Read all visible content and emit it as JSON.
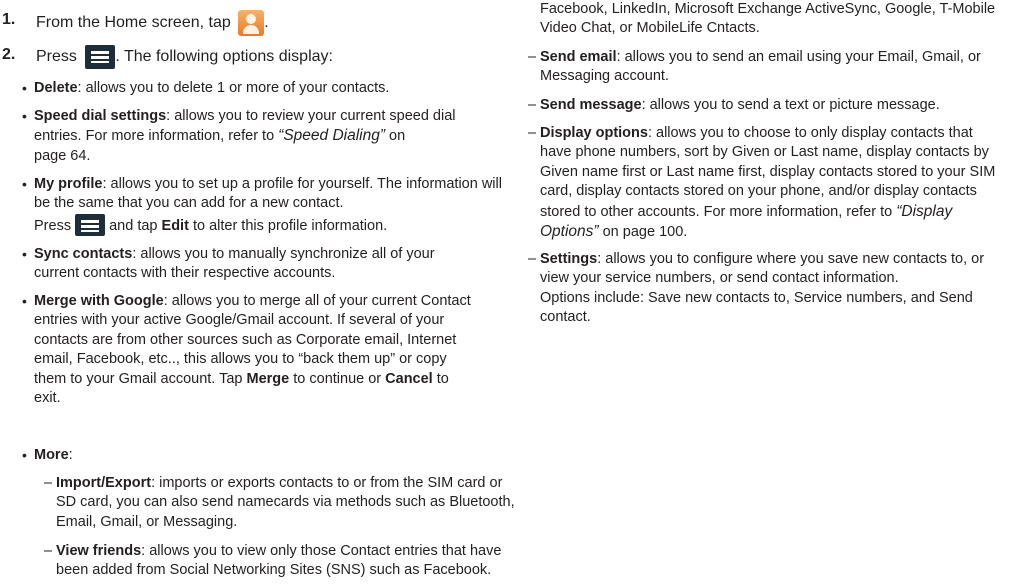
{
  "step1": {
    "num": "1.",
    "text_a": "From the Home screen, tap",
    "text_b": "."
  },
  "step2": {
    "num": "2.",
    "text_a": "Press",
    "text_b": ". The following options display:"
  },
  "left_items": {
    "delete": {
      "label": "Delete",
      "text": ": allows you to delete 1 or more of your contacts."
    },
    "speed": {
      "label": "Speed dial settings",
      "l1": ": allows you to review your current speed dial",
      "l2a": "entries. For more information, refer to ",
      "ref": "“Speed Dialing”",
      "l2b": "  on",
      "l3": "page 64."
    },
    "profile": {
      "label": "My profile",
      "l1": ": allows you to set up a profile for yourself. The information will",
      "l2": "be the same that you can add for a new contact.",
      "l3a": "Press ",
      "l3b": " and tap ",
      "edit": "Edit",
      "l3c": " to alter this profile information."
    },
    "sync": {
      "label": "Sync contacts",
      "l1": ": allows you to manually synchronize all of your",
      "l2": "current contacts with their respective accounts."
    },
    "merge": {
      "label": "Merge with Google",
      "l1": ": allows you to merge all of your current Contact",
      "l2": "entries with your active Google/Gmail account. If several of your",
      "l3": "contacts are from other sources such as Corporate email, Internet",
      "l4": "email, Facebook, etc.., this allows you to “back them up” or copy",
      "l5a": "them to your Gmail account. Tap ",
      "merge_btn": "Merge",
      "l5b": " to continue or ",
      "cancel_btn": "Cancel",
      "l5c": " to",
      "l6": "exit."
    },
    "more": {
      "label": "More",
      "text": ":"
    },
    "import": {
      "label": "Import/Export",
      "l1": ": imports or exports contacts to or from the SIM card or",
      "l2": "SD card, you can also send namecards via methods such as Bluetooth,",
      "l3": "Email, Gmail, or Messaging."
    },
    "friends": {
      "label": "View friends",
      "l1": ": allows you to view only those Contact entries that have",
      "l2": "been added from Social Networking Sites (SNS) such as Facebook."
    }
  },
  "right_items": {
    "cont": {
      "l1": "Facebook, LinkedIn, Microsoft Exchange ActiveSync, Google, T-Mobile",
      "l2": "Video Chat, or MobileLife Cntacts."
    },
    "email": {
      "label": "Send email",
      "l1": ": allows you to send an email using your Email, Gmail, or",
      "l2": "Messaging account."
    },
    "message": {
      "label": "Send message",
      "text": ": allows you to send a text or picture message."
    },
    "display": {
      "label": "Display options",
      "l1": ": allows you to choose to only display contacts that",
      "l2": "have phone numbers, sort by Given or Last name, display contacts by",
      "l3": "Given name first or Last name first, display contacts stored to your SIM",
      "l4": "card, display contacts stored on your phone, and/or display contacts",
      "l5a": "stored to other accounts. For more information, refer to ",
      "ref1": "“Display",
      "ref2": "Options”",
      "l6b": "  on page 100."
    },
    "settings": {
      "label": "Settings",
      "l1": ": allows you to configure where you save new contacts to, or",
      "l2": "view your service numbers, or send contact information.",
      "l3": "Options include: Save new contacts to, Service numbers, and Send",
      "l4": "contact."
    }
  },
  "icons": {
    "contacts": "contacts-app-icon",
    "menu": "menu-key-icon"
  }
}
